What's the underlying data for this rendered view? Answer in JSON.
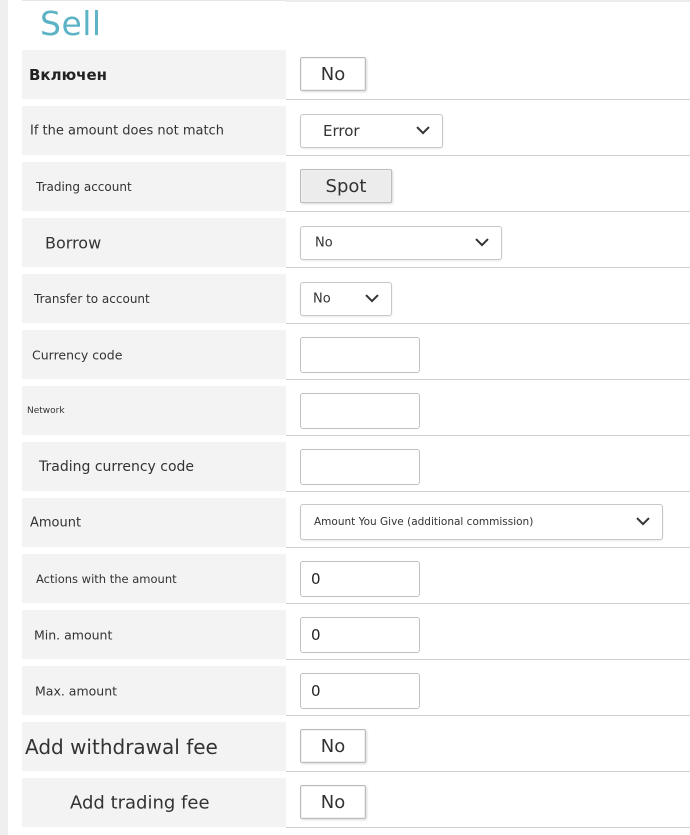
{
  "title": "Sell",
  "rows": [
    {
      "label": "Включен",
      "control": "toggle",
      "value": "No"
    },
    {
      "label": "If the amount does not match",
      "control": "select",
      "value": "Error"
    },
    {
      "label": "Trading account",
      "control": "toggle",
      "value": "Spot"
    },
    {
      "label": "Borrow",
      "control": "select",
      "value": "No"
    },
    {
      "label": "Transfer to account",
      "control": "select",
      "value": "No"
    },
    {
      "label": "Currency code",
      "control": "input",
      "value": ""
    },
    {
      "label": "Network",
      "control": "input",
      "value": ""
    },
    {
      "label": "Trading currency code",
      "control": "input",
      "value": ""
    },
    {
      "label": "Amount",
      "control": "select",
      "value": "Amount You Give (additional commission)"
    },
    {
      "label": "Actions with the amount",
      "control": "input",
      "value": "0"
    },
    {
      "label": "Min. amount",
      "control": "input",
      "value": "0"
    },
    {
      "label": "Max. amount",
      "control": "input",
      "value": "0"
    },
    {
      "label": "Add withdrawal fee",
      "control": "toggle",
      "value": "No"
    },
    {
      "label": "Add trading fee",
      "control": "toggle",
      "value": "No"
    }
  ],
  "icons": {
    "dropdown": "chevron-down-icon"
  },
  "colors": {
    "title": "#5cb3c6",
    "label_bg": "#f3f3f3",
    "border": "#c7c7c7"
  }
}
